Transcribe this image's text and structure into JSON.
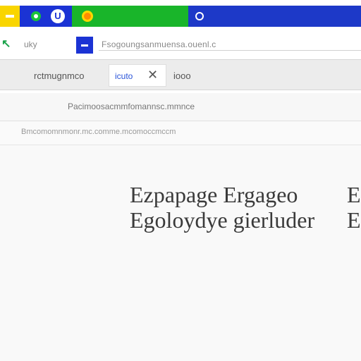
{
  "topbar": {
    "segments": [
      "yellow",
      "blue",
      "green",
      "blue"
    ],
    "colors": {
      "yellow": "#f9d500",
      "blue": "#1b33d4",
      "green": "#19b52a"
    },
    "icons": [
      "app-o-icon",
      "app-u-icon",
      "orange-dot-icon",
      "ring-icon"
    ]
  },
  "bar2": {
    "label": "uky",
    "text": "Fsogoungsanmuensa.ouenl.c"
  },
  "toolbar": {
    "label": "rctmugnmco",
    "tab_label": "icuto",
    "zoom": "iooo"
  },
  "address": {
    "text": "Pacimoosacmmfomannsc.mmnce"
  },
  "header": {
    "text": "Bmcomomnmonr.mc.comme.mcomoccmccm"
  },
  "content": {
    "line1": "Ezpapage Ergageo",
    "line2": "Egoloydye gierluder",
    "edge1": "E",
    "edge2": "E"
  }
}
